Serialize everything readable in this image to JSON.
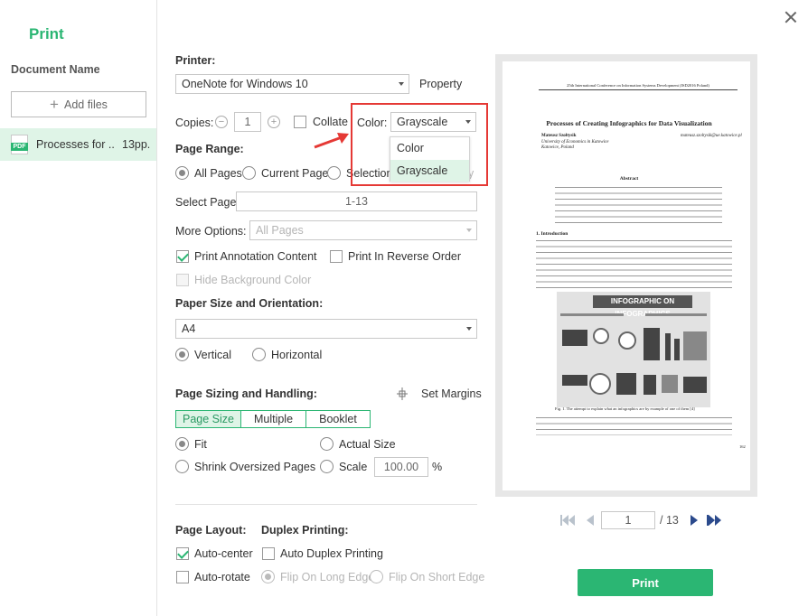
{
  "dialog": {
    "title": "Print"
  },
  "sidebar": {
    "heading": "Document Name",
    "add_files": "Add files",
    "documents": [
      {
        "name": "Processes for ..",
        "pages": "13pp.",
        "type": "PDF"
      }
    ]
  },
  "printer": {
    "label": "Printer:",
    "value": "OneNote for Windows 10",
    "property": "Property"
  },
  "copies": {
    "label": "Copies:",
    "value": "1",
    "collate": "Collate"
  },
  "color": {
    "label": "Color:",
    "value": "Grayscale",
    "options": [
      "Color",
      "Grayscale"
    ],
    "hidden_fragment": "y"
  },
  "page_range": {
    "heading": "Page Range:",
    "all_pages": "All Pages",
    "current_page": "Current Page",
    "selection": "Selection",
    "select_page_label": "Select Page:",
    "select_page_value": "1-13"
  },
  "more_options": {
    "label": "More Options:",
    "value": "All Pages",
    "print_annotation": "Print Annotation Content",
    "reverse_order": "Print In Reverse Order",
    "hide_background": "Hide Background Color"
  },
  "paper": {
    "heading": "Paper Size and Orientation:",
    "size": "A4",
    "vertical": "Vertical",
    "horizontal": "Horizontal"
  },
  "sizing": {
    "heading": "Page Sizing and Handling:",
    "set_margins": "Set Margins",
    "tabs": [
      "Page Size",
      "Multiple",
      "Booklet"
    ],
    "fit": "Fit",
    "actual_size": "Actual Size",
    "shrink": "Shrink Oversized Pages",
    "scale": "Scale",
    "scale_value": "100.00",
    "percent": "%"
  },
  "layout": {
    "heading": "Page Layout:",
    "auto_center": "Auto-center",
    "auto_rotate": "Auto-rotate"
  },
  "duplex": {
    "heading": "Duplex Printing:",
    "auto_duplex": "Auto Duplex Printing",
    "long_edge": "Flip On Long Edge",
    "short_edge": "Flip On Short Edge"
  },
  "preview": {
    "conference": "25th International Conference on Information Systems Development (ISD2016 Poland)",
    "paper_title": "Processes of Creating Infographics for Data Visualization",
    "author": "Mateusz Szołtysik",
    "affiliation": "University of Economics in Katowice",
    "city": "Katowice, Poland",
    "email": "mateusz.szoltysik@ue.katowice.pl",
    "abstract_heading": "Abstract",
    "intro_heading": "1.   Introduction",
    "infographic_banner": "INFOGRAPHIC ON INFOGRAPHICS",
    "figure_caption": "Fig. 1. The attempt to explain what an infographics are by example of one of them [4]",
    "page_number": "162"
  },
  "pager": {
    "current": "1",
    "total": "/ 13"
  },
  "print_button": "Print",
  "colors": {
    "accent": "#2bb673",
    "highlight": "#e53935",
    "selected_bg": "#dff4e7"
  }
}
